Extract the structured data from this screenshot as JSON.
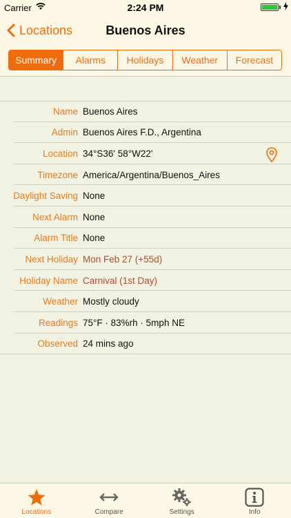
{
  "status": {
    "carrier": "Carrier",
    "time": "2:24 PM"
  },
  "nav": {
    "back_label": "Locations",
    "title": "Buenos Aires"
  },
  "segments": [
    {
      "label": "Summary",
      "active": true
    },
    {
      "label": "Alarms",
      "active": false
    },
    {
      "label": "Holidays",
      "active": false
    },
    {
      "label": "Weather",
      "active": false
    },
    {
      "label": "Forecast",
      "active": false
    }
  ],
  "details": [
    {
      "label": "Name",
      "value": "Buenos Aires"
    },
    {
      "label": "Admin",
      "value": "Buenos Aires F.D., Argentina"
    },
    {
      "label": "Location",
      "value": "34°S36' 58°W22'"
    },
    {
      "label": "Timezone",
      "value": "America/Argentina/Buenos_Aires"
    },
    {
      "label": "Daylight Saving",
      "value": "None"
    },
    {
      "label": "Next Alarm",
      "value": "None"
    },
    {
      "label": "Alarm Title",
      "value": "None"
    },
    {
      "label": "Next Holiday",
      "value": "Mon Feb 27 (+55d)"
    },
    {
      "label": "Holiday Name",
      "value": "Carnival (1st Day)"
    },
    {
      "label": "Weather",
      "value": "Mostly cloudy"
    },
    {
      "label": "Readings",
      "value": "75°F · 83%rh · 5mph NE"
    },
    {
      "label": "Observed",
      "value": "24 mins ago"
    }
  ],
  "tabs": [
    {
      "label": "Locations",
      "icon": "star-icon",
      "active": true
    },
    {
      "label": "Compare",
      "icon": "arrows-icon",
      "active": false
    },
    {
      "label": "Settings",
      "icon": "gears-icon",
      "active": false
    },
    {
      "label": "Info",
      "icon": "info-icon",
      "active": false
    }
  ],
  "colors": {
    "accent": "#ef6c0c",
    "background": "#f1f2e1",
    "bar": "#fcf6e5",
    "label": "#e07b1f",
    "holiday_value": "#b04a2e"
  }
}
